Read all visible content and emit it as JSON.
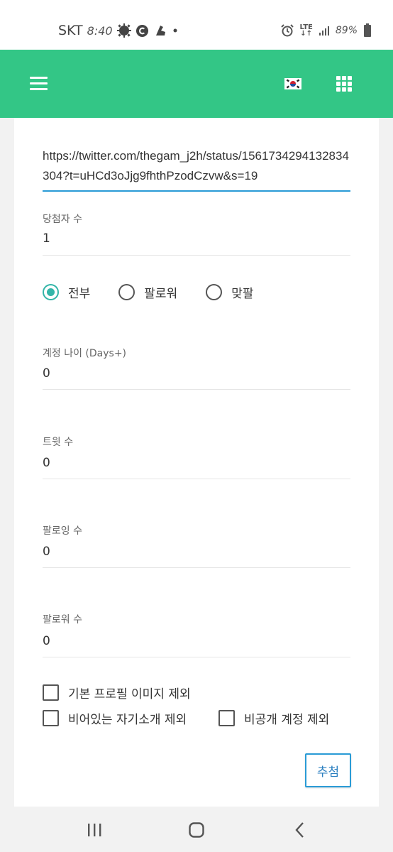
{
  "status_bar": {
    "carrier": "SKT",
    "time": "8:40",
    "network": "LTE",
    "battery": "89%",
    "icons": [
      "settings-gear-icon",
      "c-icon",
      "shoe-icon",
      "dot-icon",
      "alarm-icon",
      "signal-icon",
      "battery-icon"
    ]
  },
  "app_bar": {
    "color": "#33c686",
    "menu_icon": "hamburger-menu-icon",
    "language_icon": "korea-flag-icon",
    "apps_icon": "grid-apps-icon"
  },
  "form": {
    "url_value": "https://twitter.com/thegam_j2h/status/1561734294132834304?t=uHCd3oJjg9fhthPzodCzvw&s=19",
    "winners_label": "당첨자 수",
    "winners_value": "1",
    "radio_options": [
      {
        "label": "전부",
        "checked": true
      },
      {
        "label": "팔로워",
        "checked": false
      },
      {
        "label": "맞팔",
        "checked": false
      }
    ],
    "account_age_label": "계정 나이 (Days+)",
    "account_age_value": "0",
    "tweets_label": "트윗 수",
    "tweets_value": "0",
    "following_label": "팔로잉 수",
    "following_value": "0",
    "followers_label": "팔로워 수",
    "followers_value": "0",
    "checkboxes": [
      {
        "label": "기본 프로필 이미지 제외",
        "checked": false
      },
      {
        "label": "비어있는 자기소개 제외",
        "checked": false
      },
      {
        "label": "비공개 계정 제외",
        "checked": false
      }
    ],
    "draw_button": "추첨",
    "accent_color": "#33b5a8",
    "focus_color": "#2a9bd6"
  },
  "nav_bar": {
    "icons": [
      "recent-apps-icon",
      "home-icon",
      "back-icon"
    ]
  }
}
